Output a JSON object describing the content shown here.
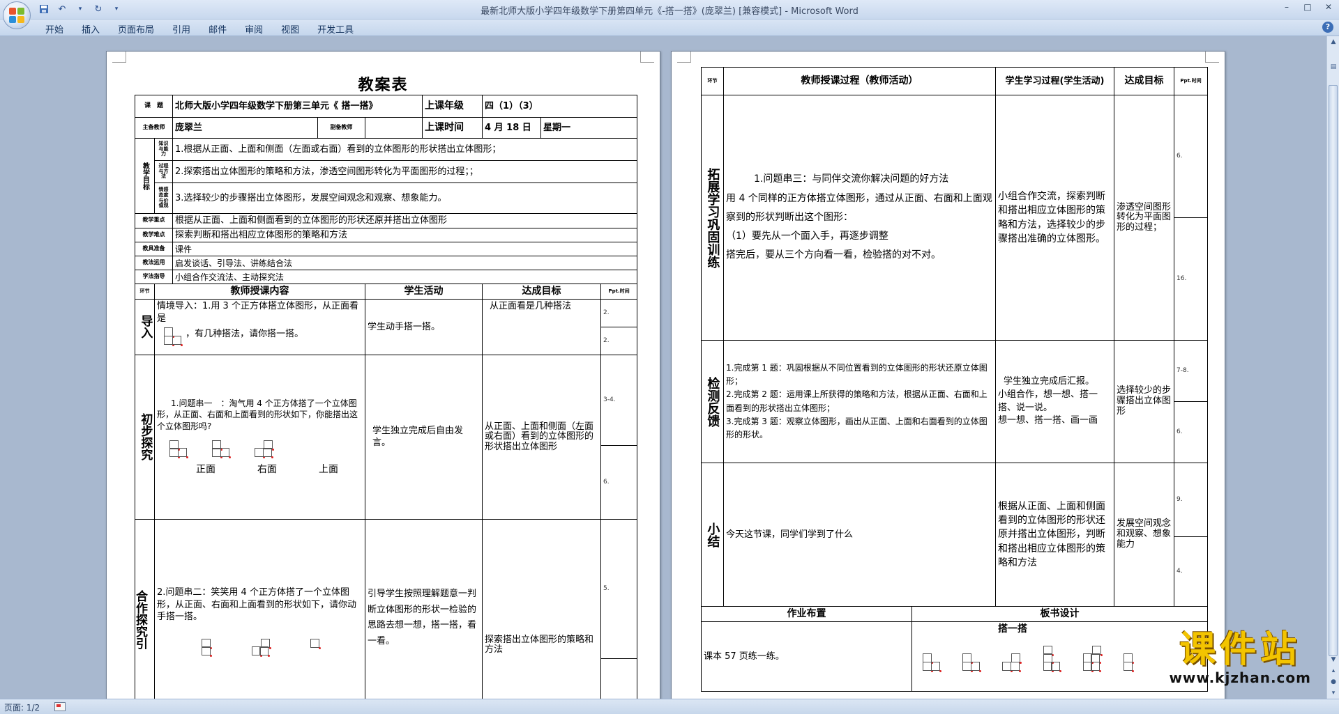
{
  "window": {
    "title": "最新北师大版小学四年级数学下册第四单元《-搭一搭》(庞翠兰) [兼容模式] - Microsoft Word"
  },
  "qat": {
    "save_icon": "save-icon",
    "undo_icon": "undo-icon",
    "redo_icon": "redo-icon",
    "customize_icon": "dropdown-icon"
  },
  "ribbon": {
    "tabs": [
      "开始",
      "插入",
      "页面布局",
      "引用",
      "邮件",
      "审阅",
      "视图",
      "开发工具"
    ]
  },
  "status": {
    "page": "页面: 1/2"
  },
  "watermark": {
    "title": "课件站",
    "url": "www.kjzhan.com"
  },
  "left_page": {
    "title": "教案表",
    "subject_label": "课　题",
    "subject": "北师大版小学四年级数学下册第三单元《 搭一搭》",
    "grade_label": "上课年级",
    "grade": "四（1）（3）",
    "teacher_label": "主备教师",
    "teacher": "庞翠兰",
    "co_teacher_label": "副备教师",
    "time_label": "上课时间",
    "time_date": "4 月 18 日",
    "time_day": "星期一",
    "goals_label": "教学目标",
    "goal_sub1": "知识与能力",
    "goal_sub2": "过程与方法",
    "goal_sub3": "情感态度与价值观",
    "goal1": "1.根据从正面、上面和侧面（左面或右面）看到的立体图形的形状搭出立体图形；",
    "goal2": "2.探索搭出立体图形的策略和方法，渗透空间图形转化为平面图形的过程；；",
    "goal3": "3.选择较少的步骤搭出立体图形，发展空间观念和观察、想象能力。",
    "key_label": "教学重点",
    "key": "根据从正面、上面和侧面看到的立体图形的形状还原并搭出立体图形",
    "difficulty_label": "教学难点",
    "difficulty": "探索判断和搭出相应立体图形的策略和方法",
    "tools_label": "教具准备",
    "tools": "课件",
    "method_label": "教法运用",
    "method": "启发谈话、引导法、讲练结合法",
    "study_label": "学法指导",
    "study": "小组合作交流法、主动探究法",
    "col_stage": "环节",
    "col_teacher": "教师授课内容",
    "col_student": "学生活动",
    "col_goal": "达成目标",
    "col_time": "Ppt.时间",
    "s1_label": "导入",
    "s1_text_a": "情境导入：1.用 3 个正方体搭立体图形，从正面看是",
    "s1_text_b": "，有几种搭法，请你搭一搭。",
    "s1_student": "学生动手搭一搭。",
    "s1_goal": "从正面看是几种搭法",
    "s1_t1": "2.",
    "s1_t2": "2.",
    "s2_label": "初步探究",
    "s2_text": "1.问题串一　：淘气用 4 个正方体搭了一个立体图形，从正面、右面和上面看到的形状如下，你能搭出这个立体图形吗?",
    "s2_view1": "正面",
    "s2_view2": "右面",
    "s2_view3": "上面",
    "s2_student": "学生独立完成后自由发言。",
    "s2_goal": "从正面、上面和侧面（左面或右面）看到的立体图形的形状搭出立体图形",
    "s2_t1": "3-4.",
    "s2_t2": "6.",
    "s3_label": "合作探究引",
    "s3_text": "2.问题串二：笑笑用 4 个正方体搭了一个立体图形，从正面、右面和上面看到的形状如下，请你动手搭一搭。",
    "s3_student": "引导学生按照理解题意一判断立体图形的形状一检验的思路去想一想，搭一搭，看一看。",
    "s3_goal": "探索搭出立体图形的策略和方法",
    "s3_t1": "5."
  },
  "right_page": {
    "col_stage": "环节",
    "col_teacher": "教师授课过程（教师活动）",
    "col_student": "学生学习过程(学生活动)",
    "col_goal": "达成目标",
    "col_time": "Ppt.时间",
    "r1_label": "拓展学习巩固训练",
    "r1_text1": "1.问题串三：与同伴交流你解决问题的好方法",
    "r1_text2": "用 4 个同样的正方体搭立体图形，通过从正面、右面和上面观察到的形状判断出这个图形：",
    "r1_text3": "（1）要先从一个面入手，再逐步调整",
    "r1_text4": "搭完后，要从三个方向看一看，检验搭的对不对。",
    "r1_student": "小组合作交流，探索判断和搭出相应立体图形的策略和方法，选择较少的步骤搭出准确的立体图形。",
    "r1_goal": "渗透空间图形转化为平面图形的过程；",
    "r1_t1": "6.",
    "r1_t2": "16.",
    "r2_label": "检测反馈",
    "r2_text1": "1.完成第 1 题：巩固根据从不同位置看到的立体图形的形状还原立体图形；",
    "r2_text2": "2.完成第 2 题：运用课上所获得的策略和方法，根据从正面、右面和上面看到的形状搭出立体图形；",
    "r2_text3": "3.完成第 3 题：观察立体图形，画出从正面、上面和右面看到的立体图形的形状。",
    "r2_student1": "学生独立完成后汇报。",
    "r2_student2": "小组合作，想一想、搭一搭、说一说。",
    "r2_student3": "想一想、搭一搭、画一画",
    "r2_goal": "选择较少的步骤搭出立体图形",
    "r2_t1": "7-8.",
    "r2_t2": "6.",
    "r3_label": "小结",
    "r3_text": "今天这节课，同学们学到了什么",
    "r3_student": "根据从正面、上面和侧面看到的立体图形的形状还原并搭出立体图形，判断和搭出相应立体图形的策略和方法",
    "r3_goal": "发展空间观念和观察、想象能力",
    "r3_t1": "9.",
    "r3_t2": "4.",
    "hw_label": "作业布置",
    "board_label": "板书设计",
    "hw": "课本 57 页练一练。",
    "board_title": "搭一搭"
  }
}
